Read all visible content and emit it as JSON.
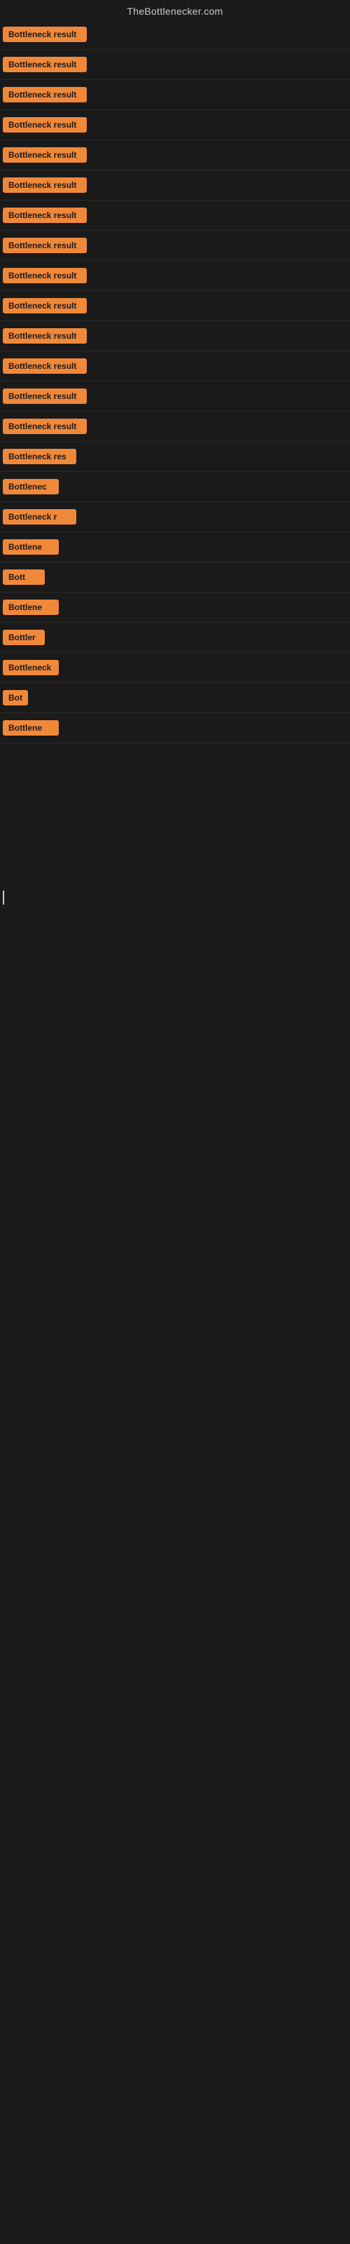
{
  "site": {
    "title": "TheBottlenecker.com"
  },
  "items": [
    {
      "id": 1,
      "label": "Bottleneck result",
      "size": "full"
    },
    {
      "id": 2,
      "label": "Bottleneck result",
      "size": "full"
    },
    {
      "id": 3,
      "label": "Bottleneck result",
      "size": "full"
    },
    {
      "id": 4,
      "label": "Bottleneck result",
      "size": "full"
    },
    {
      "id": 5,
      "label": "Bottleneck result",
      "size": "full"
    },
    {
      "id": 6,
      "label": "Bottleneck result",
      "size": "full"
    },
    {
      "id": 7,
      "label": "Bottleneck result",
      "size": "full"
    },
    {
      "id": 8,
      "label": "Bottleneck result",
      "size": "full"
    },
    {
      "id": 9,
      "label": "Bottleneck result",
      "size": "full"
    },
    {
      "id": 10,
      "label": "Bottleneck result",
      "size": "full"
    },
    {
      "id": 11,
      "label": "Bottleneck result",
      "size": "full"
    },
    {
      "id": 12,
      "label": "Bottleneck result",
      "size": "full"
    },
    {
      "id": 13,
      "label": "Bottleneck result",
      "size": "full"
    },
    {
      "id": 14,
      "label": "Bottleneck result",
      "size": "full"
    },
    {
      "id": 15,
      "label": "Bottleneck res",
      "size": "slightly-cut"
    },
    {
      "id": 16,
      "label": "Bottlenec",
      "size": "more-cut"
    },
    {
      "id": 17,
      "label": "Bottleneck r",
      "size": "slightly-cut"
    },
    {
      "id": 18,
      "label": "Bottlene",
      "size": "more-cut"
    },
    {
      "id": 19,
      "label": "Bott",
      "size": "half"
    },
    {
      "id": 20,
      "label": "Bottlene",
      "size": "more-cut"
    },
    {
      "id": 21,
      "label": "Bottler",
      "size": "half"
    },
    {
      "id": 22,
      "label": "Bottleneck",
      "size": "more-cut"
    },
    {
      "id": 23,
      "label": "Bot",
      "size": "tiny"
    },
    {
      "id": 24,
      "label": "Bottlene",
      "size": "more-cut"
    }
  ]
}
